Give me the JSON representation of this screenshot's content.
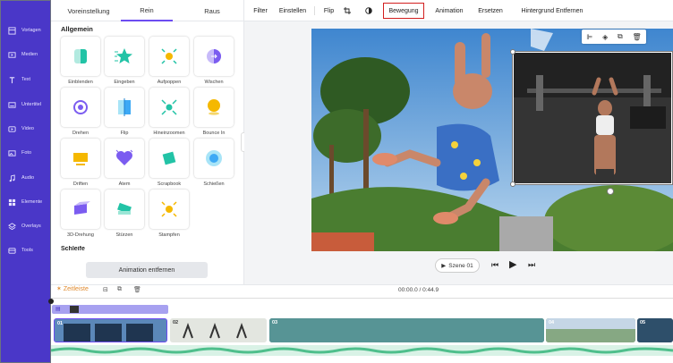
{
  "nav": {
    "items": [
      {
        "label": "Vorlagen",
        "icon": "templates-icon"
      },
      {
        "label": "Medien",
        "icon": "media-icon"
      },
      {
        "label": "Text",
        "icon": "text-icon"
      },
      {
        "label": "Untertitel",
        "icon": "subtitles-icon"
      },
      {
        "label": "Video",
        "icon": "video-icon"
      },
      {
        "label": "Foto",
        "icon": "photo-icon"
      },
      {
        "label": "Audio",
        "icon": "audio-icon"
      },
      {
        "label": "Elemente",
        "icon": "elements-icon"
      },
      {
        "label": "Overlays",
        "icon": "overlays-icon"
      },
      {
        "label": "Tools",
        "icon": "tools-icon"
      }
    ]
  },
  "panel": {
    "tabs": [
      "Voreinstellung",
      "Rein",
      "Raus"
    ],
    "active_tab": "Rein",
    "section_title": "Allgemein",
    "next_section": "Schleife",
    "animations": [
      "Einblenden",
      "Eingeben",
      "Aufpoppen",
      "Wischen",
      "Drehen",
      "Flip",
      "Hineinzoomen",
      "Bounce In",
      "Driften",
      "Atem",
      "Scrapbook",
      "Schießen",
      "3D-Drehung",
      "Stürzen",
      "Stampfen"
    ],
    "remove_button": "Animation entfernen"
  },
  "toolbar": {
    "items": [
      "Filter",
      "Einstellen",
      "Flip",
      "Bewegung",
      "Animation",
      "Ersetzen",
      "Hintergrund Entfernen"
    ],
    "selected": "Bewegung",
    "crop_icon": "crop-icon",
    "contrast_icon": "contrast-icon"
  },
  "preview": {
    "scene_label": "Szene 01",
    "mini_toolbar_icons": [
      "align-icon",
      "layers-icon",
      "duplicate-icon",
      "delete-icon"
    ]
  },
  "timeline": {
    "label": "Zeitleiste",
    "time": "00:00.0 / 0:44.9",
    "clips": [
      "01",
      "02",
      "03",
      "04",
      "05"
    ]
  },
  "colors": {
    "nav_bg": "#4a37c8",
    "accent": "#6c4cf1",
    "highlight_border": "#d21f1f",
    "icon_teal": "#22c3a6",
    "icon_yellow": "#f5b800",
    "icon_purple": "#7b5cf0",
    "icon_blue": "#3da9f5"
  }
}
